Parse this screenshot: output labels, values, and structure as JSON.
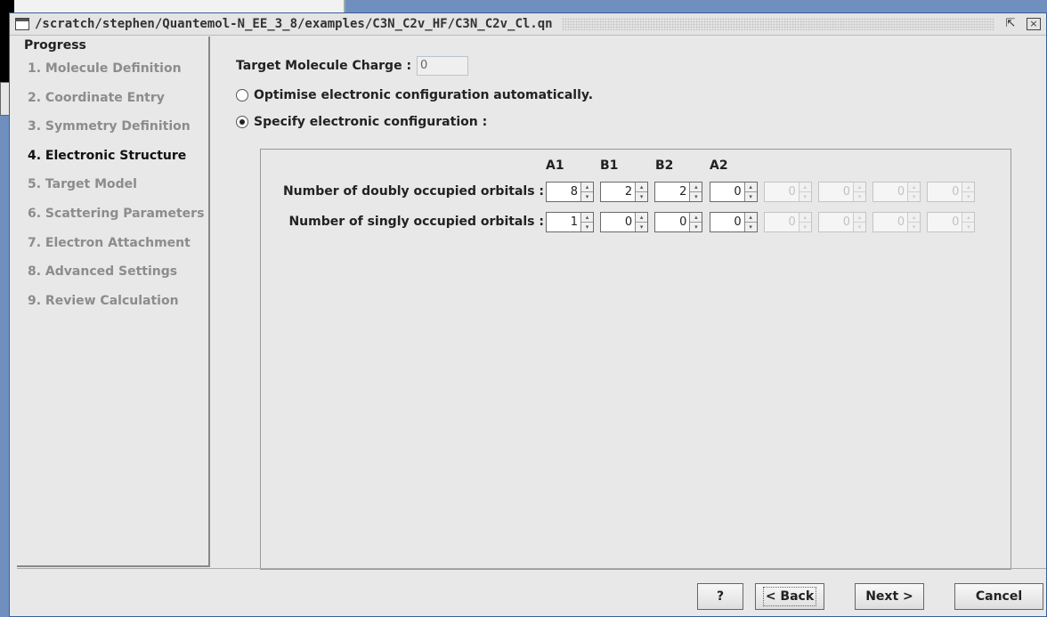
{
  "window": {
    "title": "/scratch/stephen/Quantemol-N_EE_3_8/examples/C3N_C2v_HF/C3N_C2v_Cl.qn",
    "maximize_glyph": "⇱",
    "close_glyph": "×"
  },
  "sidebar": {
    "heading": "Progress",
    "items": [
      {
        "label": "1. Molecule Definition",
        "active": false
      },
      {
        "label": "2. Coordinate Entry",
        "active": false
      },
      {
        "label": "3. Symmetry Definition",
        "active": false
      },
      {
        "label": "4. Electronic Structure",
        "active": true
      },
      {
        "label": "5. Target Model",
        "active": false
      },
      {
        "label": "6. Scattering Parameters",
        "active": false
      },
      {
        "label": "7. Electron Attachment",
        "active": false
      },
      {
        "label": "8. Advanced Settings",
        "active": false
      },
      {
        "label": "9. Review Calculation",
        "active": false
      }
    ]
  },
  "charge": {
    "label": "Target Molecule Charge :",
    "value": "0"
  },
  "options": {
    "auto_label": "Optimise electronic configuration automatically.",
    "auto_checked": false,
    "specify_label": "Specify electronic configuration :",
    "specify_checked": true
  },
  "config": {
    "columns": [
      "A1",
      "B1",
      "B2",
      "A2"
    ],
    "doubly_label": "Number of doubly occupied orbitals :",
    "singly_label": "Number of singly occupied orbitals :",
    "doubly_values": [
      "8",
      "2",
      "2",
      "0",
      "0",
      "0",
      "0",
      "0"
    ],
    "singly_values": [
      "1",
      "0",
      "0",
      "0",
      "0",
      "0",
      "0",
      "0"
    ],
    "enabled_count": 4
  },
  "footer": {
    "help_label": "?",
    "back_label": "< Back",
    "next_label": "Next >",
    "cancel_label": "Cancel"
  }
}
